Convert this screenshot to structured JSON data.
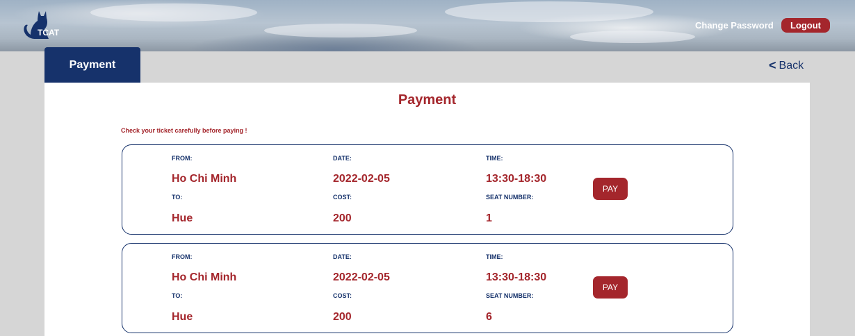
{
  "header": {
    "logo_text": "TCAT",
    "change_password_label": "Change Password",
    "logout_label": "Logout"
  },
  "nav": {
    "active_tab": "Payment",
    "back_label": "Back"
  },
  "main": {
    "title": "Payment",
    "notice": "Check your ticket carefully before paying !",
    "labels": {
      "from": "FROM:",
      "to": "TO:",
      "date": "DATE:",
      "cost": "COST:",
      "time": "TIME:",
      "seat": "SEAT NUMBER:"
    },
    "pay_label": "PAY",
    "tickets": [
      {
        "from": "Ho Chi Minh",
        "to": "Hue",
        "date": "2022-02-05",
        "cost": "200",
        "time": "13:30-18:30",
        "seat": "1"
      },
      {
        "from": "Ho Chi Minh",
        "to": "Hue",
        "date": "2022-02-05",
        "cost": "200",
        "time": "13:30-18:30",
        "seat": "6"
      }
    ]
  },
  "colors": {
    "brand_navy": "#16326b",
    "accent_red": "#a4262c"
  }
}
